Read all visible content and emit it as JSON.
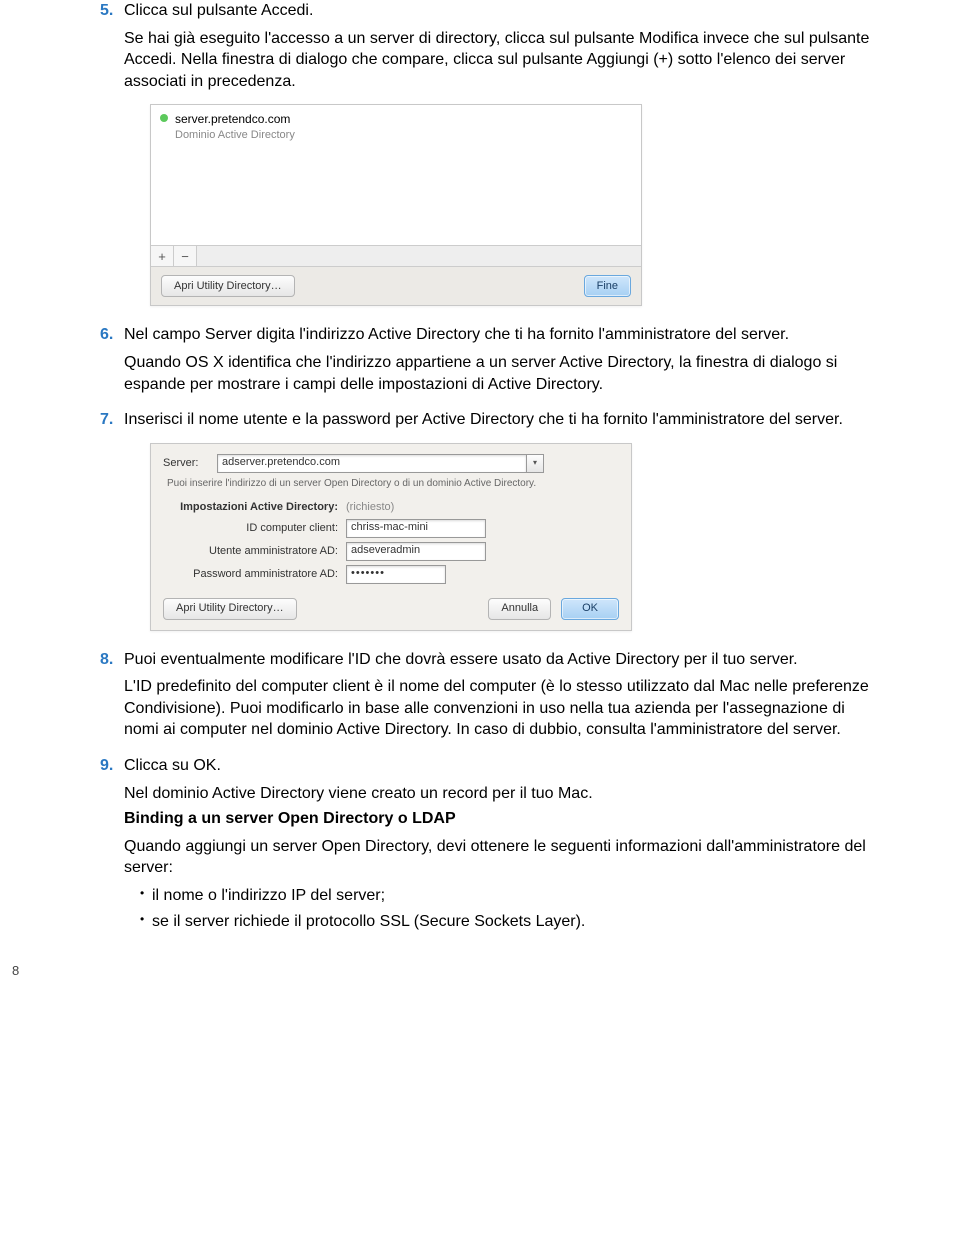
{
  "steps": {
    "s5": {
      "num": "5.",
      "head": "Clicca sul pulsante Accedi.",
      "p1": "Se hai già eseguito l'accesso a un server di directory, clicca sul pulsante Modifica invece che sul pulsante Accedi. Nella finestra di dialogo che compare, clicca sul pulsante Aggiungi (+) sotto l'elenco dei server associati in precedenza."
    },
    "s6": {
      "num": "6.",
      "head": "Nel campo Server digita l'indirizzo Active Directory che ti ha fornito l'amministratore del server.",
      "p1": "Quando OS X identifica che l'indirizzo appartiene a un server Active Directory, la finestra di dialogo si espande per mostrare i campi delle impostazioni di Active Directory."
    },
    "s7": {
      "num": "7.",
      "head": "Inserisci il nome utente e la password per Active Directory che ti ha fornito l'amministratore del server."
    },
    "s8": {
      "num": "8.",
      "head": "Puoi eventualmente modificare l'ID che dovrà essere usato da Active Directory per il tuo server.",
      "p1": "L'ID predefinito del computer client è il nome del computer (è lo stesso utilizzato dal Mac nelle preferenze Condivisione). Puoi modificarlo in base alle convenzioni in uso nella tua azienda per l'assegnazione di nomi ai computer nel dominio Active Directory. In caso di dubbio, consulta l'amministratore del server."
    },
    "s9": {
      "num": "9.",
      "head": "Clicca su OK.",
      "p1": "Nel dominio Active Directory viene creato un record per il tuo Mac.",
      "sub": "Binding a un server Open Directory o LDAP",
      "p2": "Quando aggiungi un server Open Directory, devi ottenere le seguenti informazioni dall'amministratore del server:",
      "b1": "il nome o l'indirizzo IP del server;",
      "b2": "se il server richiede il protocollo SSL (Secure Sockets Layer)."
    }
  },
  "ss1": {
    "server_name": "server.pretendco.com",
    "server_type": "Dominio Active Directory",
    "plus": "+",
    "minus": "−",
    "open_util": "Apri Utility Directory…",
    "fine": "Fine"
  },
  "ss2": {
    "server_label": "Server:",
    "server_value": "adserver.pretendco.com",
    "help": "Puoi inserire l'indirizzo di un server Open Directory o di un dominio Active Directory.",
    "ad_settings": "Impostazioni Active Directory:",
    "ad_required": "(richiesto)",
    "id_label": "ID computer client:",
    "id_value": "chriss-mac-mini",
    "user_label": "Utente amministratore AD:",
    "user_value": "adseveradmin",
    "pass_label": "Password amministratore AD:",
    "pass_value": "•••••••",
    "open_util": "Apri Utility Directory…",
    "cancel": "Annulla",
    "ok": "OK"
  },
  "page_number": "8"
}
